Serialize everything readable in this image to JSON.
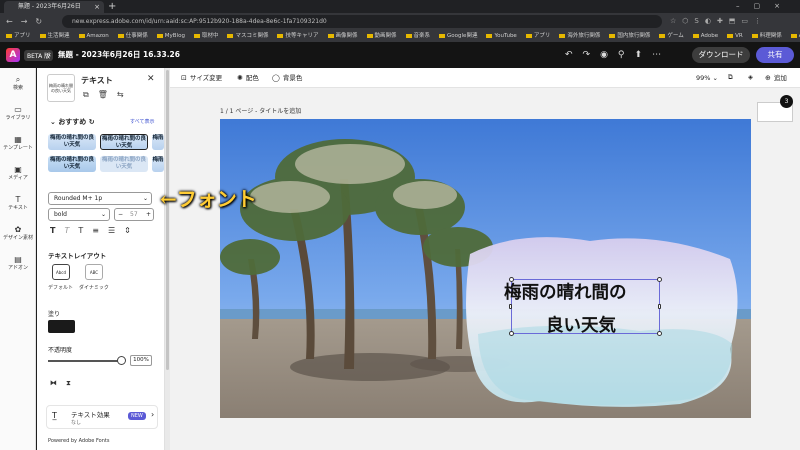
{
  "browser": {
    "tab_title": "無題 - 2023年6月26日 16.33.26",
    "url": "new.express.adobe.com/id/urn:aaid:sc:AP:9512b920-188a-4dea-8e6c-1fa7109321d0",
    "bookmarks": [
      "アプリ",
      "生活関連",
      "Amazon",
      "仕事関係",
      "MyBlog",
      "取材中",
      "マスコミ関係",
      "技等キャリア",
      "画像関係",
      "動画関係",
      "音楽系",
      "Google関連",
      "YouTube",
      "アプリ",
      "海外旅行関係",
      "国内旅行関係",
      "ゲーム",
      "Adobe",
      "VR",
      "料理関係",
      "AI"
    ]
  },
  "app": {
    "beta": "BETA 版",
    "doc_title": "無題 - 2023年6月26日 16.33.26",
    "download": "ダウンロード",
    "share": "共有"
  },
  "rail": [
    {
      "icon": "search-icon",
      "glyph": "⌕",
      "label": "検索"
    },
    {
      "icon": "folder-icon",
      "glyph": "▭",
      "label": "ライブラリ"
    },
    {
      "icon": "template-icon",
      "glyph": "▦",
      "label": "テンプレート"
    },
    {
      "icon": "media-icon",
      "glyph": "▣",
      "label": "メディア"
    },
    {
      "icon": "text-icon",
      "glyph": "T",
      "label": "テキスト"
    },
    {
      "icon": "design-icon",
      "glyph": "✿",
      "label": "デザイン素材"
    },
    {
      "icon": "addon-icon",
      "glyph": "▤",
      "label": "アドオン"
    }
  ],
  "panel": {
    "thumb_text": "梅雨の晴れ間の良い天気",
    "title": "テキスト",
    "recommended": "おすすめ",
    "see_all": "すべて表示",
    "presets": [
      "梅雨の晴れ間の良い天気",
      "梅雨の晴れ間の良い天気",
      "梅雨",
      "梅雨の晴れ間の良い天気",
      "梅雨の晴れ間の良い天気",
      "梅雨"
    ],
    "font": "Rounded M+ 1p",
    "weight": "bold",
    "size_minus": "−",
    "size_value": "57",
    "size_plus": "+",
    "layout_title": "テキストレイアウト",
    "layout_default": "デフォルト",
    "layout_dynamic": "ダイナミック",
    "layout_default_icon": "Abcd",
    "layout_dynamic_icon": "ABC",
    "fill_title": "塗り",
    "fill_color": "#1a1a1a",
    "opacity_title": "不透明度",
    "opacity_value": "100%",
    "effect_label": "テキスト効果",
    "effect_sub": "なし",
    "new_badge": "NEW",
    "powered": "Powered by Adobe Fonts"
  },
  "toolbar": {
    "resize": "サイズ変更",
    "color": "配色",
    "background": "背景色",
    "zoom": "99%",
    "add": "追加"
  },
  "canvas": {
    "page_label": "1 / 1 ページ - タイトルを追加",
    "page_count": "3",
    "text_line1": "梅雨の晴れ間の",
    "text_line2": "良い天気"
  },
  "annotation": "←フォント"
}
